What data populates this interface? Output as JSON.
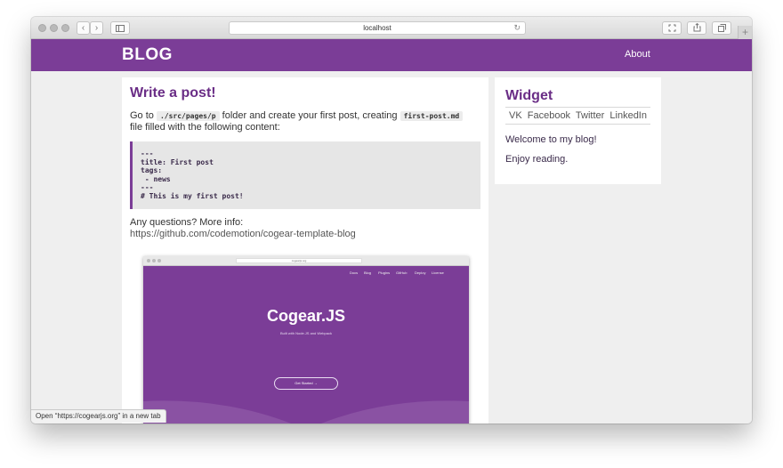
{
  "browser": {
    "address": "localhost",
    "status_text": "Open “https://cogearjs.org” in a new tab",
    "back_icon": "chevron-left-icon",
    "forward_icon": "chevron-right-icon"
  },
  "navbar": {
    "brand": "BLOG",
    "about": "About",
    "color": "#7b3d97"
  },
  "post": {
    "title": "Write a post!",
    "intro_before": "Go to",
    "path_code": "./src/pages/p",
    "intro_middle": "folder and create your first post, creating",
    "file_code": "first-post.md",
    "intro_after": "file filled with the following content:",
    "code_lines": [
      "---",
      "title: First post",
      "tags:",
      " - news",
      "---",
      "# This is my first post!"
    ],
    "questions": "Any questions? More info:",
    "link": "https://github.com/codemotion/cogear-template-blog"
  },
  "screenshot": {
    "address": "cogearjs.org",
    "nav_items": [
      "Docs",
      "Blog",
      "Plugins",
      "GitHub",
      "Deploy",
      "License"
    ],
    "title": "Cogear.JS",
    "subtitle": "Built with Node.JS and Webpack",
    "button": "Get Started →"
  },
  "widget": {
    "title": "Widget",
    "social": [
      "VK",
      "Facebook",
      "Twitter",
      "LinkedIn"
    ],
    "welcome": "Welcome to my blog!",
    "enjoy": "Enjoy reading."
  }
}
